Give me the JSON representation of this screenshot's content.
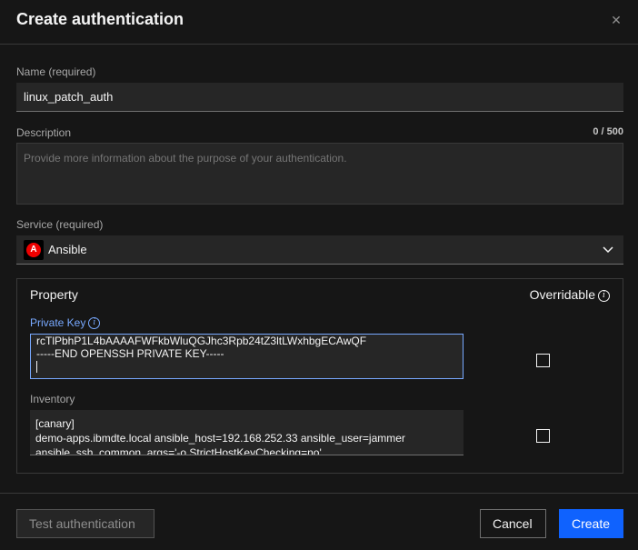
{
  "modal": {
    "title": "Create authentication",
    "close_icon": "close-icon"
  },
  "name": {
    "label": "Name (required)",
    "value": "linux_patch_auth"
  },
  "description": {
    "label": "Description",
    "counter": "0 / 500",
    "placeholder": "Provide more information about the purpose of your authentication."
  },
  "service": {
    "label": "Service (required)",
    "value": "Ansible",
    "icon": "ansible-logo-icon"
  },
  "properties": {
    "property_header": "Property",
    "overridable_header": "Overridable",
    "private_key": {
      "label": "Private Key",
      "lines": [
        "rcTlPbhP1L4bAAAAFWFkbWluQGJhc3Rpb24tZ3ltLWxhbgECAwQF",
        "-----END OPENSSH PRIVATE KEY-----"
      ],
      "overridable": false
    },
    "inventory": {
      "label": "Inventory",
      "lines": [
        "[canary]",
        "demo-apps.ibmdte.local ansible_host=192.168.252.33 ansible_user=jammer",
        "ansible_ssh_common_args='-o StrictHostKeyChecking=no'"
      ],
      "overridable": false
    }
  },
  "footer": {
    "test_label": "Test authentication",
    "cancel_label": "Cancel",
    "create_label": "Create"
  },
  "colors": {
    "background": "#161616",
    "accent": "#0f62fe",
    "focus": "#78a9ff",
    "field": "#262626"
  }
}
